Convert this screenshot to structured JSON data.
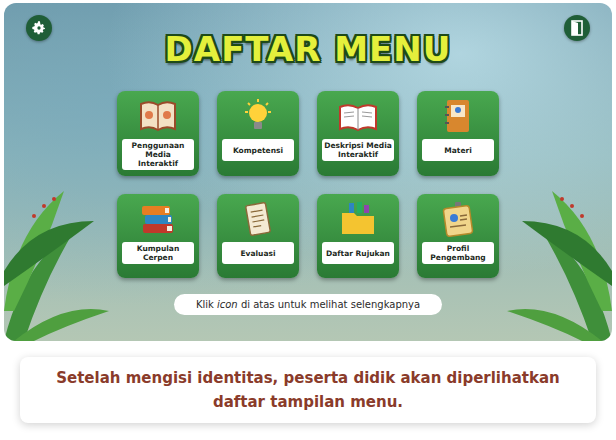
{
  "header": {
    "title": "DAFTAR MENU"
  },
  "menu": [
    {
      "label": "Penggunaan Media Interaktif"
    },
    {
      "label": "Kompetensi"
    },
    {
      "label": "Deskripsi Media Interaktif"
    },
    {
      "label": "Materi"
    },
    {
      "label": "Kumpulan Cerpen"
    },
    {
      "label": "Evaluasi"
    },
    {
      "label": "Daftar Rujukan"
    },
    {
      "label": "Profil Pengembang"
    }
  ],
  "hint": {
    "before": "Klik ",
    "emphasis": "icon",
    "after": " di atas untuk melihat selengkapnya"
  },
  "caption": "Setelah mengisi identitas, peserta didik akan diperlihatkan daftar tampilan menu."
}
